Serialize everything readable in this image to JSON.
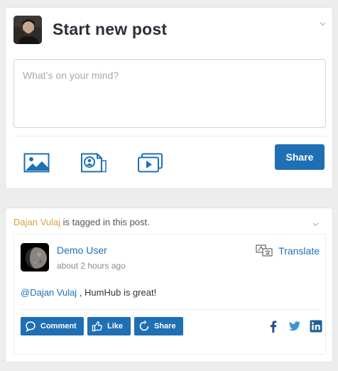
{
  "composer": {
    "title": "Start new post",
    "placeholder": "What’s on your mind?",
    "submit_label": "Share",
    "tools": [
      "image-icon",
      "file-icon",
      "video-icon"
    ],
    "collapse_icon": "chevron-down-icon"
  },
  "entry": {
    "tagged_user": "Dajan Vulaj",
    "tagged_text": " is tagged in this post.",
    "collapse_icon": "chevron-down-icon",
    "author": "Demo User",
    "timestamp": "about 2 hours ago",
    "translate_label": "Translate",
    "mention": "@Dajan Vulaj",
    "message": " , HumHub is great!",
    "actions": {
      "comment_label": "Comment",
      "like_label": "Like",
      "share_label": "Share"
    },
    "social": [
      "facebook-icon",
      "twitter-icon",
      "linkedin-icon"
    ]
  },
  "colors": {
    "accent": "#1f6fb5",
    "tagged_user": "#d8a13f",
    "background": "#ededed"
  }
}
